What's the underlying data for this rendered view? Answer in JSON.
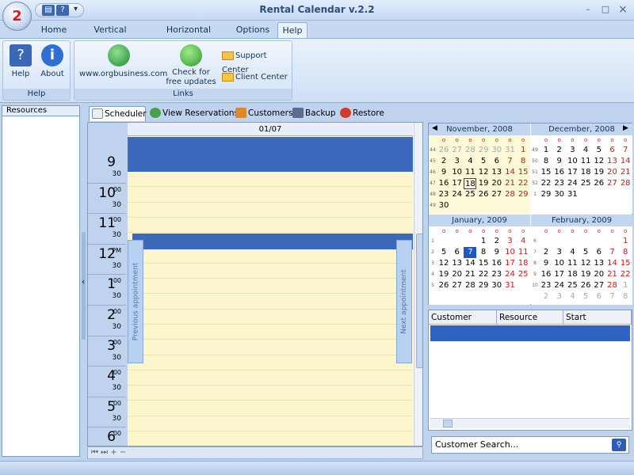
{
  "window": {
    "title": "Rental Calendar v.2.2",
    "minimize": "–",
    "maximize": "□",
    "close": "×"
  },
  "qat": {
    "arrow": "▾"
  },
  "ribbon_tabs": [
    "Home",
    "Vertical Timeline",
    "Horizontal Timeline",
    "Options",
    "Help"
  ],
  "ribbon": {
    "help_group": {
      "caption": "Help",
      "help_label": "Help",
      "about_label": "About"
    },
    "links_group": {
      "caption": "Links",
      "website_label": "www.orgbusiness.com",
      "update_label_1": "Check for",
      "update_label_2": "free updates",
      "support_label": "Support Center",
      "client_label": "Client Center"
    }
  },
  "resources": {
    "title": "Resources"
  },
  "view_tabs": {
    "scheduler": "Scheduler",
    "view_reservations": "View Reservations",
    "customers": "Customers",
    "backup": "Backup",
    "restore": "Restore"
  },
  "scheduler": {
    "date": "01/07",
    "prev_label": "Previous appointment",
    "next_label": "Next appointment",
    "hours": [
      {
        "h": "9",
        "m": "",
        "m2": "30"
      },
      {
        "h": "10",
        "m": "00",
        "m2": "30"
      },
      {
        "h": "11",
        "m": "00",
        "m2": "30"
      },
      {
        "h": "12",
        "m": "PM",
        "m2": "30"
      },
      {
        "h": "1",
        "m": "00",
        "m2": "30"
      },
      {
        "h": "2",
        "m": "00",
        "m2": "30"
      },
      {
        "h": "3",
        "m": "00",
        "m2": "30"
      },
      {
        "h": "4",
        "m": "00",
        "m2": "30"
      },
      {
        "h": "5",
        "m": "00",
        "m2": "30"
      },
      {
        "h": "6",
        "m": "00",
        "m2": ""
      }
    ],
    "bottom_nav": "⏮  ⏭  +  −"
  },
  "calendar": {
    "dow": [
      "o",
      "o",
      "o",
      "o",
      "o",
      "o",
      "o"
    ],
    "months": [
      {
        "title": "November, 2008",
        "weeks": [
          "44",
          "45",
          "46",
          "47",
          "48",
          "49"
        ],
        "start": 5,
        "days": 30,
        "prev_tail": [
          "26",
          "27",
          "28",
          "29",
          "30",
          "31"
        ],
        "selected": 18,
        "today": null
      },
      {
        "title": "December, 2008",
        "weeks": [
          "49",
          "50",
          "51",
          "52",
          "1"
        ],
        "start": 0,
        "days": 31,
        "prev_tail": [],
        "selected": null,
        "today": null
      },
      {
        "title": "January, 2009",
        "weeks": [
          "1",
          "2",
          "3",
          "4",
          "5"
        ],
        "start": 3,
        "days": 31,
        "prev_tail": [],
        "selected": null,
        "today": 7
      },
      {
        "title": "February, 2009",
        "weeks": [
          "6",
          "7",
          "8",
          "9",
          "10"
        ],
        "start": 6,
        "days": 28,
        "prev_tail": [],
        "selected": null,
        "today": null,
        "next_tail": [
          "1",
          "2",
          "3",
          "4",
          "5",
          "6",
          "7",
          "8",
          "9",
          "10",
          "11",
          "12",
          "13",
          "14"
        ]
      }
    ]
  },
  "grid": {
    "columns": [
      "Customer",
      "Resource",
      "Start"
    ]
  },
  "search": {
    "placeholder": "Customer Search..."
  },
  "colors": {
    "accent": "#3d69bd",
    "slot": "#fcf6cf",
    "weekend": "#c01b1b"
  }
}
